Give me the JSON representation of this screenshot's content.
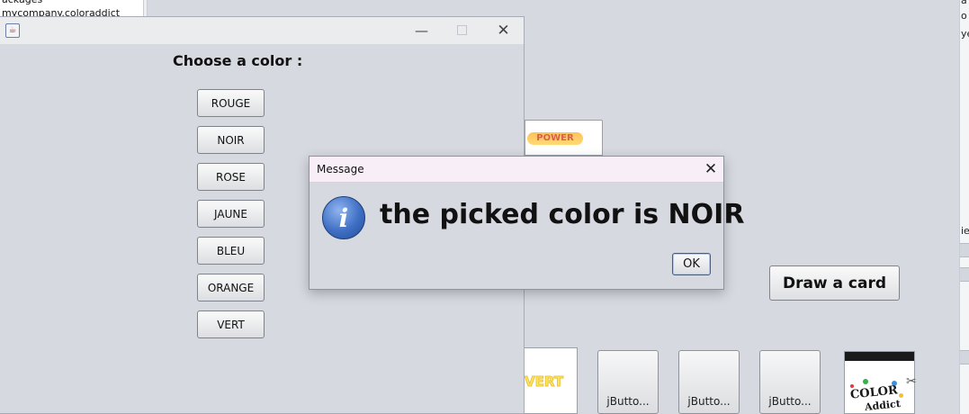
{
  "background": {
    "tree_lines": [
      "ackages",
      "mycompany.coloraddict"
    ],
    "right_strip_lines": [
      "a",
      "o",
      "ye",
      "ie"
    ]
  },
  "game": {
    "card_left_text": "VERT",
    "card_top_text": "POWER",
    "buttons": [
      "jButto...",
      "jButto...",
      "jButto..."
    ],
    "draw_card_label": "Draw a card",
    "deck_logo_text": [
      "COLOR",
      "Addict"
    ]
  },
  "chooser": {
    "prompt": "Choose a color :",
    "colors": [
      "ROUGE",
      "NOIR",
      "ROSE",
      "JAUNE",
      "BLEU",
      "ORANGE",
      "VERT"
    ]
  },
  "dialog": {
    "title": "Message",
    "message": "the picked color is NOIR",
    "ok_label": "OK"
  },
  "icons": {
    "close": "close-icon",
    "minimize": "minimize-icon",
    "maximize": "maximize-icon",
    "info": "info-icon",
    "java": "java-icon",
    "scissors": "scissors-icon"
  }
}
